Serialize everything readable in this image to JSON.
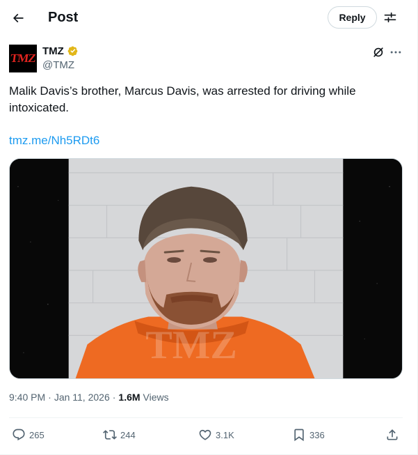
{
  "header": {
    "title": "Post",
    "reply_label": "Reply"
  },
  "author": {
    "name": "TMZ",
    "handle": "@TMZ",
    "avatar_text": "TMZ"
  },
  "post": {
    "text": "Malik Davis’s brother, Marcus Davis, was arrested for driving while intoxicated.",
    "link": "tmz.me/Nh5RDt6",
    "media_watermark": "TMZ"
  },
  "meta": {
    "time": "9:40 PM",
    "separator": "·",
    "date": "Jan 11, 2026",
    "views_count": "1.6M",
    "views_label": "Views"
  },
  "actions": {
    "replies": "265",
    "reposts": "244",
    "likes": "3.1K",
    "bookmarks": "336"
  },
  "colors": {
    "link": "#1d9bf0",
    "secondary_text": "#536471",
    "verified_gold": "#e2b719",
    "brand_red": "#e0241f"
  },
  "icons": [
    "back-arrow-icon",
    "filter-icon",
    "verified-icon",
    "grok-icon",
    "more-icon",
    "reply-icon",
    "repost-icon",
    "like-icon",
    "bookmark-icon",
    "share-icon"
  ]
}
